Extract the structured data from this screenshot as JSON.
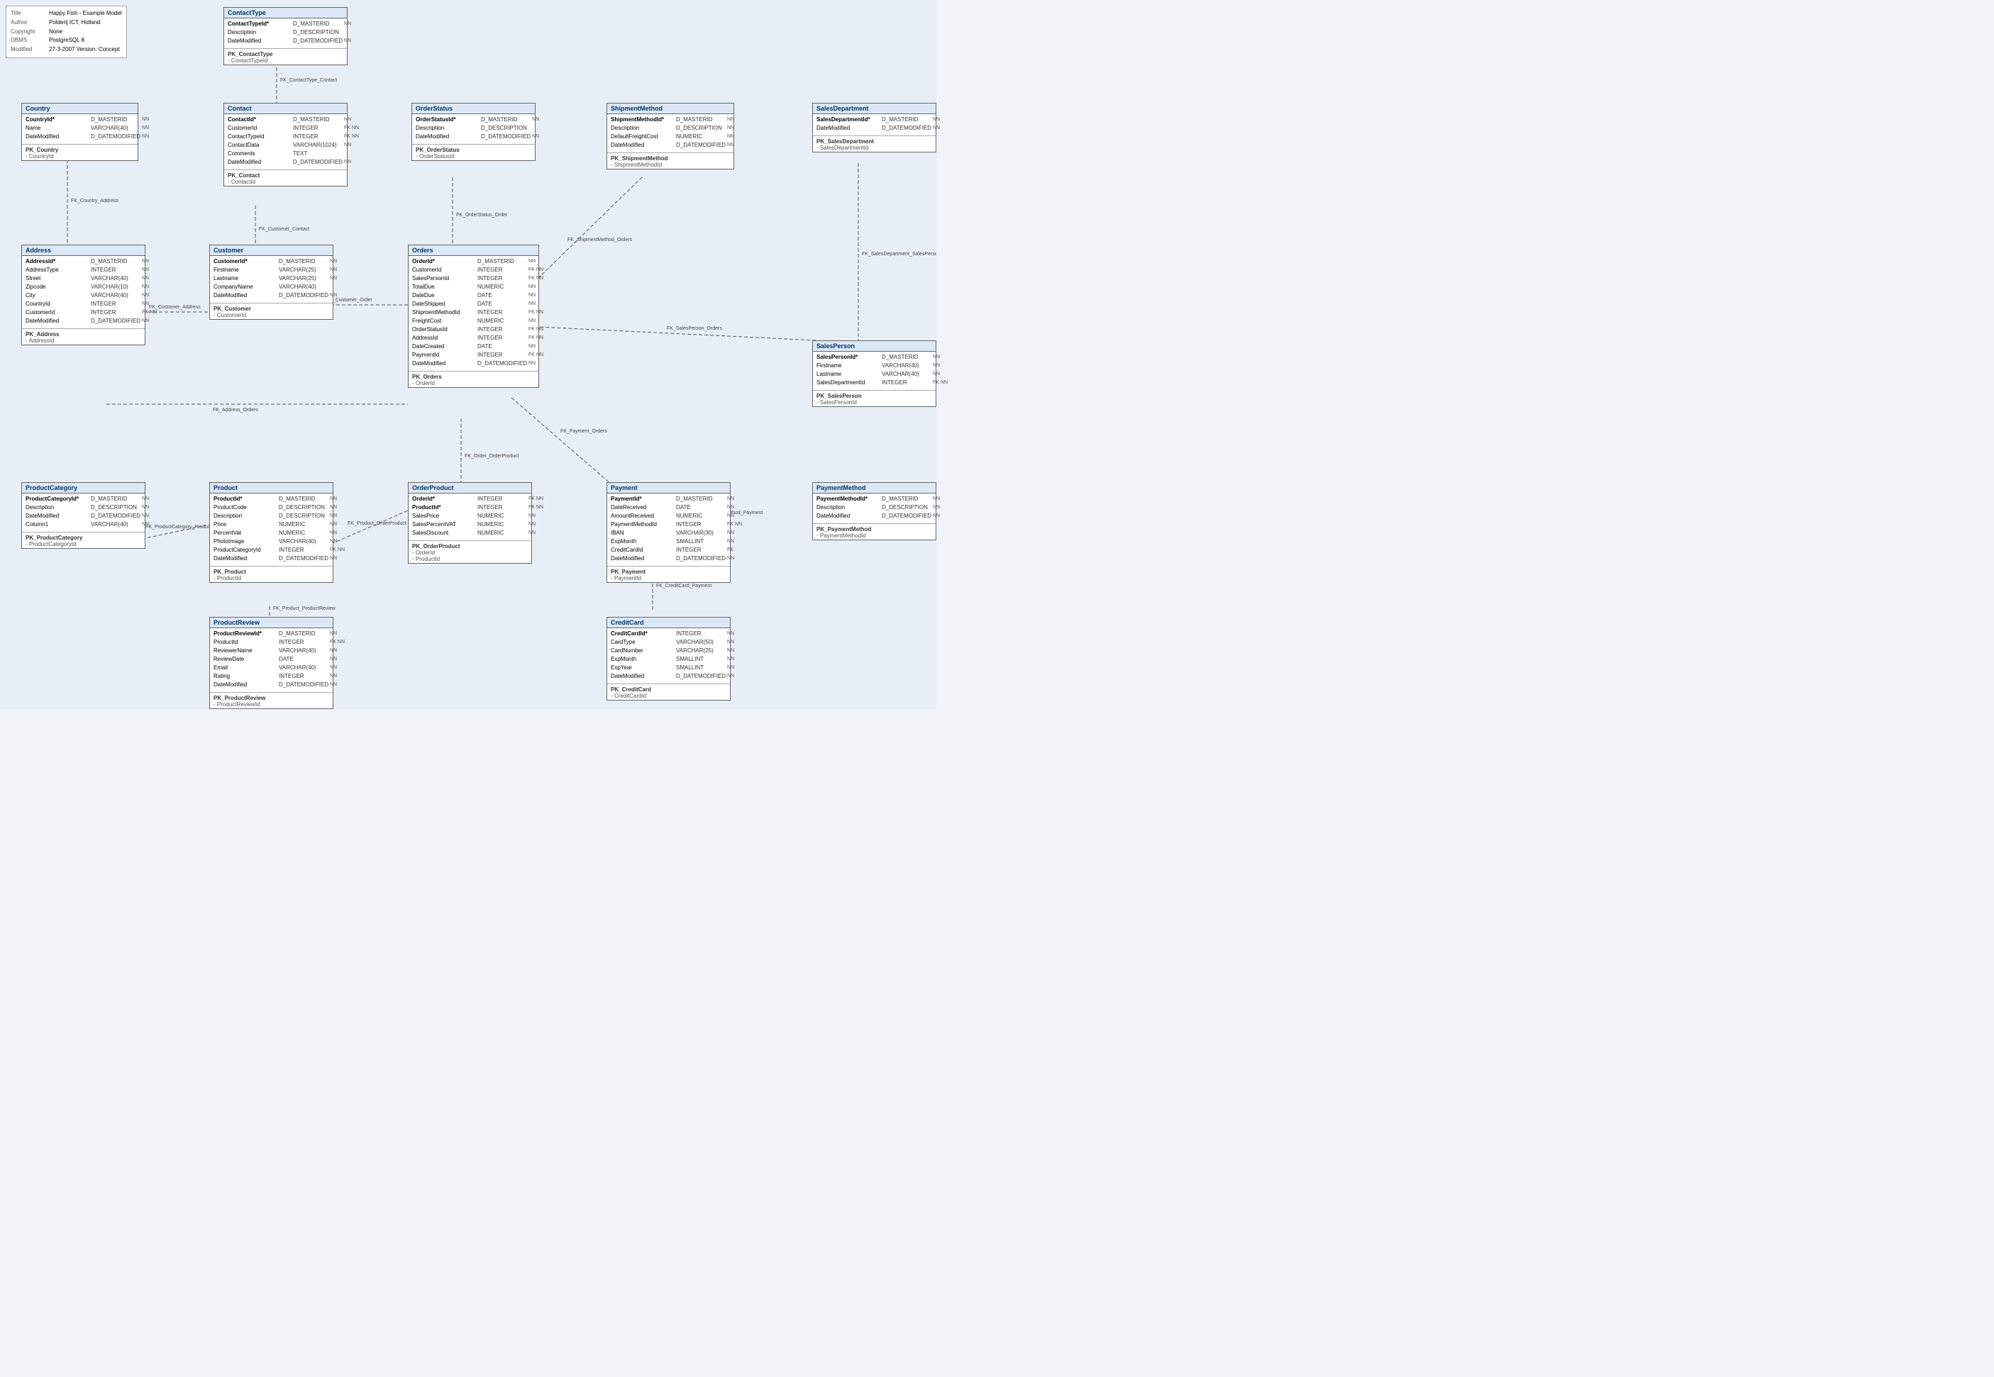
{
  "meta": {
    "title_label": "Title",
    "title_value": "Happy Fish - Example Model",
    "author_label": "Author",
    "author_value": "Polderij ICT, Holland",
    "copyright_label": "Copyright",
    "copyright_value": "None",
    "dbms_label": "DBMS",
    "dbms_value": "PostgreSQL 8",
    "modified_label": "Modified",
    "modified_value": "27-3-2007 Version: Concept"
  },
  "entities": {
    "contactType": {
      "title": "ContactType",
      "fields": [
        {
          "name": "ContactTypeId*",
          "type": "D_MASTERID",
          "flags": [
            "NN"
          ],
          "pk": true
        },
        {
          "name": "Description",
          "type": "D_DESCRIPTION",
          "flags": []
        },
        {
          "name": "DateModified",
          "type": "D_DATEMODIFIED",
          "flags": [
            "NN"
          ]
        }
      ],
      "pk": "PK_ContactType",
      "pk_fields": [
        "- ContactTypeId"
      ]
    },
    "contact": {
      "title": "Contact",
      "fields": [
        {
          "name": "ContactId*",
          "type": "D_MASTERID",
          "flags": [
            "NN"
          ],
          "pk": true
        },
        {
          "name": "CustomerId",
          "type": "INTEGER",
          "flags": [
            "FK",
            "NN"
          ]
        },
        {
          "name": "ContactTypeId",
          "type": "INTEGER",
          "flags": [
            "FK",
            "NN"
          ]
        },
        {
          "name": "ContactData",
          "type": "VARCHAR(1024)",
          "flags": [
            "NN"
          ]
        },
        {
          "name": "Comments",
          "type": "TEXT",
          "flags": []
        },
        {
          "name": "DateModified",
          "type": "D_DATEMODIFIED",
          "flags": [
            "NN"
          ]
        }
      ],
      "pk": "PK_Contact",
      "pk_fields": [
        "- ContactId"
      ]
    },
    "orderStatus": {
      "title": "OrderStatus",
      "fields": [
        {
          "name": "OrderStatusId*",
          "type": "D_MASTERID",
          "flags": [
            "NN"
          ],
          "pk": true
        },
        {
          "name": "Description",
          "type": "D_DESCRIPTION",
          "flags": []
        },
        {
          "name": "DateModified",
          "type": "D_DATEMODIFIED",
          "flags": [
            "NN"
          ]
        }
      ],
      "pk": "PK_OrderStatus",
      "pk_fields": [
        "- OrderStatusId"
      ]
    },
    "shipmentMethod": {
      "title": "ShipmentMethod",
      "fields": [
        {
          "name": "ShipmentMethodId*",
          "type": "D_MASTERID",
          "flags": [
            "NN"
          ],
          "pk": true
        },
        {
          "name": "Description",
          "type": "D_DESCRIPTION",
          "flags": [
            "NN"
          ]
        },
        {
          "name": "DefaultFreightCost",
          "type": "NUMERIC",
          "flags": [
            "NN"
          ]
        },
        {
          "name": "DateModified",
          "type": "D_DATEMODIFIED",
          "flags": [
            "NN"
          ]
        }
      ],
      "pk": "PK_ShipmentMethod",
      "pk_fields": [
        "- ShipmentMethodId"
      ]
    },
    "salesDepartment": {
      "title": "SalesDepartment",
      "fields": [
        {
          "name": "SalesDepartmentId*",
          "type": "D_MASTERID",
          "flags": [
            "NN"
          ],
          "pk": true
        },
        {
          "name": "DateModified",
          "type": "D_DATEMODIFIED",
          "flags": [
            "NN"
          ]
        }
      ],
      "pk": "PK_SalesDepartment",
      "pk_fields": [
        "- SalesDepartmentId"
      ]
    },
    "country": {
      "title": "Country",
      "fields": [
        {
          "name": "CountryId*",
          "type": "D_MASTERID",
          "flags": [
            "NN"
          ],
          "pk": true
        },
        {
          "name": "Name",
          "type": "VARCHAR(40)",
          "flags": [
            "NN"
          ]
        },
        {
          "name": "DateModified",
          "type": "D_DATEMODIFIED",
          "flags": [
            "NN"
          ]
        }
      ],
      "pk": "PK_Country",
      "pk_fields": [
        "- CountryId"
      ]
    },
    "address": {
      "title": "Address",
      "fields": [
        {
          "name": "AddressId*",
          "type": "D_MASTERID",
          "flags": [
            "NN"
          ],
          "pk": true
        },
        {
          "name": "AddressType",
          "type": "INTEGER",
          "flags": [
            "NN"
          ]
        },
        {
          "name": "Street",
          "type": "VARCHAR(40)",
          "flags": [
            "NN"
          ]
        },
        {
          "name": "Zipcode",
          "type": "VARCHAR(10)",
          "flags": [
            "NN"
          ]
        },
        {
          "name": "City",
          "type": "VARCHAR(40)",
          "flags": [
            "NN"
          ]
        },
        {
          "name": "CountryId",
          "type": "INTEGER",
          "flags": [
            "NN"
          ]
        },
        {
          "name": "CustomerId",
          "type": "INTEGER",
          "flags": [
            "FK",
            "NN"
          ]
        },
        {
          "name": "DateModified",
          "type": "D_DATEMODIFIED",
          "flags": [
            "NN"
          ]
        }
      ],
      "pk": "PK_Address",
      "pk_fields": [
        "- AddressId"
      ]
    },
    "customer": {
      "title": "Customer",
      "fields": [
        {
          "name": "CustomerId*",
          "type": "D_MASTERID",
          "flags": [
            "NN"
          ],
          "pk": true
        },
        {
          "name": "Firstname",
          "type": "VARCHAR(25)",
          "flags": [
            "NN"
          ]
        },
        {
          "name": "Lastname",
          "type": "VARCHAR(25)",
          "flags": [
            "NN"
          ]
        },
        {
          "name": "CompanyName",
          "type": "VARCHAR(40)",
          "flags": []
        },
        {
          "name": "DateModified",
          "type": "D_DATEMODIFIED",
          "flags": [
            "NN"
          ]
        }
      ],
      "pk": "PK_Customer",
      "pk_fields": [
        "- CustomerId"
      ]
    },
    "orders": {
      "title": "Orders",
      "fields": [
        {
          "name": "OrderId*",
          "type": "D_MASTERID",
          "flags": [
            "NN"
          ],
          "pk": true
        },
        {
          "name": "CustomerId",
          "type": "INTEGER",
          "flags": [
            "FK",
            "NN"
          ]
        },
        {
          "name": "SalesPersonId",
          "type": "INTEGER",
          "flags": [
            "FK",
            "NN"
          ]
        },
        {
          "name": "TotalDue",
          "type": "NUMERIC",
          "flags": [
            "NN"
          ]
        },
        {
          "name": "DateDue",
          "type": "DATE",
          "flags": [
            "NN"
          ]
        },
        {
          "name": "DateShipped",
          "type": "DATE",
          "flags": [
            "NN"
          ]
        },
        {
          "name": "ShipmentMethodId",
          "type": "INTEGER",
          "flags": [
            "FK",
            "NN"
          ]
        },
        {
          "name": "FreightCost",
          "type": "NUMERIC",
          "flags": [
            "NN"
          ]
        },
        {
          "name": "OrderStatusId",
          "type": "INTEGER",
          "flags": [
            "FK",
            "NN"
          ]
        },
        {
          "name": "AddressId",
          "type": "INTEGER",
          "flags": [
            "FK",
            "NN"
          ]
        },
        {
          "name": "DateCreated",
          "type": "DATE",
          "flags": [
            "NN"
          ]
        },
        {
          "name": "PaymentId",
          "type": "INTEGER",
          "flags": [
            "FK",
            "NN"
          ]
        },
        {
          "name": "DateModified",
          "type": "D_DATEMODIFIED",
          "flags": [
            "NN"
          ]
        }
      ],
      "pk": "PK_Orders",
      "pk_fields": [
        "- OrderId"
      ]
    },
    "salesPerson": {
      "title": "SalesPerson",
      "fields": [
        {
          "name": "SalesPersonId*",
          "type": "D_MASTERID",
          "flags": [
            "NN"
          ],
          "pk": true
        },
        {
          "name": "Firstname",
          "type": "VARCHAR(40)",
          "flags": [
            "NN"
          ]
        },
        {
          "name": "Lastname",
          "type": "VARCHAR(40)",
          "flags": [
            "NN"
          ]
        },
        {
          "name": "SalesDepartmentId",
          "type": "INTEGER",
          "flags": [
            "FK",
            "NN"
          ]
        }
      ],
      "pk": "PK_SalesPerson",
      "pk_fields": [
        "- SalesPersonId"
      ]
    },
    "productCategory": {
      "title": "ProductCategory",
      "fields": [
        {
          "name": "ProductCategoryId*",
          "type": "D_MASTERID",
          "flags": [
            "NN"
          ],
          "pk": true
        },
        {
          "name": "Description",
          "type": "D_DESCRIPTION",
          "flags": [
            "NN"
          ]
        },
        {
          "name": "DateModified",
          "type": "D_DATEMODIFIED",
          "flags": [
            "NN"
          ]
        },
        {
          "name": "Column1",
          "type": "VARCHAR(40)",
          "flags": [
            "NN"
          ]
        }
      ],
      "pk": "PK_ProductCategory",
      "pk_fields": [
        "- ProductCategoryId"
      ]
    },
    "product": {
      "title": "Product",
      "fields": [
        {
          "name": "ProductId*",
          "type": "D_MASTERID",
          "flags": [
            "NN"
          ],
          "pk": true
        },
        {
          "name": "ProductCode",
          "type": "D_DESCRIPTION",
          "flags": [
            "NN"
          ]
        },
        {
          "name": "Description",
          "type": "D_DESCRIPTION",
          "flags": [
            "NN"
          ]
        },
        {
          "name": "Price",
          "type": "NUMERIC",
          "flags": [
            "NN"
          ]
        },
        {
          "name": "PercentVat",
          "type": "NUMERIC",
          "flags": [
            "NN"
          ]
        },
        {
          "name": "PhotoImage",
          "type": "VARCHAR(40)",
          "flags": [
            "NN"
          ]
        },
        {
          "name": "ProductCategoryId",
          "type": "INTEGER",
          "flags": [
            "FK",
            "NN"
          ]
        },
        {
          "name": "DateModified",
          "type": "D_DATEMODIFIED",
          "flags": [
            "NN"
          ]
        }
      ],
      "pk": "PK_Product",
      "pk_fields": [
        "- ProductId"
      ]
    },
    "orderProduct": {
      "title": "OrderProduct",
      "fields": [
        {
          "name": "OrderId*",
          "type": "INTEGER",
          "flags": [
            "FK",
            "NN"
          ],
          "pk": true
        },
        {
          "name": "ProductId*",
          "type": "INTEGER",
          "flags": [
            "FK",
            "NN"
          ],
          "pk": true
        },
        {
          "name": "SalesPrice",
          "type": "NUMERIC",
          "flags": [
            "NN"
          ]
        },
        {
          "name": "SalesPercentVAT",
          "type": "NUMERIC",
          "flags": [
            "NN"
          ]
        },
        {
          "name": "SalesDiscount",
          "type": "NUMERIC",
          "flags": [
            "NN"
          ]
        }
      ],
      "pk": "PK_OrderProduct",
      "pk_fields": [
        "- OrderId",
        "- ProductId"
      ]
    },
    "payment": {
      "title": "Payment",
      "fields": [
        {
          "name": "PaymentId*",
          "type": "D_MASTERID",
          "flags": [
            "NN"
          ],
          "pk": true
        },
        {
          "name": "DateReceived",
          "type": "DATE",
          "flags": [
            "NN"
          ]
        },
        {
          "name": "AmountReceived",
          "type": "NUMERIC",
          "flags": [
            "NN"
          ]
        },
        {
          "name": "PaymentMethodId",
          "type": "INTEGER",
          "flags": [
            "FK",
            "NN"
          ]
        },
        {
          "name": "IBAN",
          "type": "VARCHAR(30)",
          "flags": [
            "NN"
          ]
        },
        {
          "name": "ExpMonth",
          "type": "SMALLINT",
          "flags": [
            "NN"
          ]
        },
        {
          "name": "CreditCardId",
          "type": "INTEGER",
          "flags": [
            "FK"
          ]
        },
        {
          "name": "DateModified",
          "type": "D_DATEMODIFIED",
          "flags": [
            "NN"
          ]
        }
      ],
      "pk": "PK_Payment",
      "pk_fields": [
        "- PaymentId"
      ]
    },
    "paymentMethod": {
      "title": "PaymentMethod",
      "fields": [
        {
          "name": "PaymentMethodId*",
          "type": "D_MASTERID",
          "flags": [
            "NN"
          ],
          "pk": true
        },
        {
          "name": "Description",
          "type": "D_DESCRIPTION",
          "flags": [
            "NN"
          ]
        },
        {
          "name": "DateModified",
          "type": "D_DATEMODIFIED",
          "flags": [
            "NN"
          ]
        }
      ],
      "pk": "PK_PaymentMethod",
      "pk_fields": [
        "- PaymentMethodId"
      ]
    },
    "productReview": {
      "title": "ProductReview",
      "fields": [
        {
          "name": "ProductReviewId*",
          "type": "D_MASTERID",
          "flags": [
            "NN"
          ],
          "pk": true
        },
        {
          "name": "ProductId",
          "type": "INTEGER",
          "flags": [
            "FK",
            "NN"
          ]
        },
        {
          "name": "ReviewerName",
          "type": "VARCHAR(40)",
          "flags": [
            "NN"
          ]
        },
        {
          "name": "ReviewDate",
          "type": "DATE",
          "flags": [
            "NN"
          ]
        },
        {
          "name": "Email",
          "type": "VARCHAR(40)",
          "flags": [
            "NN"
          ]
        },
        {
          "name": "Rating",
          "type": "INTEGER",
          "flags": [
            "NN"
          ]
        },
        {
          "name": "DateModified",
          "type": "D_DATEMODIFIED",
          "flags": [
            "NN"
          ]
        }
      ],
      "pk": "PK_ProductReview",
      "pk_fields": [
        "- ProductReviewId"
      ]
    },
    "creditCard": {
      "title": "CreditCard",
      "fields": [
        {
          "name": "CreditCardId*",
          "type": "INTEGER",
          "flags": [
            "NN"
          ],
          "pk": true
        },
        {
          "name": "CardType",
          "type": "VARCHAR(50)",
          "flags": [
            "NN"
          ]
        },
        {
          "name": "CardNumber",
          "type": "VARCHAR(25)",
          "flags": [
            "NN"
          ]
        },
        {
          "name": "ExpMonth",
          "type": "SMALLINT",
          "flags": [
            "NN"
          ]
        },
        {
          "name": "ExpYear",
          "type": "SMALLINT",
          "flags": [
            "NN"
          ]
        },
        {
          "name": "DateModified",
          "type": "D_DATEMODIFIED",
          "flags": [
            "NN"
          ]
        }
      ],
      "pk": "PK_CreditCard",
      "pk_fields": [
        "- CreditCardId"
      ]
    }
  },
  "relations": [
    {
      "label": "FK_ContactType_Contact",
      "from": "contactType",
      "to": "contact"
    },
    {
      "label": "FK_Country_Address",
      "from": "country",
      "to": "address"
    },
    {
      "label": "FK_Customer_Address",
      "from": "customer",
      "to": "address"
    },
    {
      "label": "FK_Customer_Contact",
      "from": "customer",
      "to": "contact"
    },
    {
      "label": "FK_Customer_Order",
      "from": "customer",
      "to": "orders"
    },
    {
      "label": "FK_OrderStatus_Order",
      "from": "orderStatus",
      "to": "orders"
    },
    {
      "label": "FK_ShipmentMethod_Orders",
      "from": "shipmentMethod",
      "to": "orders"
    },
    {
      "label": "FK_SalesPerson_Orders",
      "from": "salesPerson",
      "to": "orders"
    },
    {
      "label": "FK_Payment_Orders",
      "from": "payment",
      "to": "orders"
    },
    {
      "label": "FK_Address_Orders",
      "from": "address",
      "to": "orders"
    },
    {
      "label": "FK_Order_OrderProduct",
      "from": "orders",
      "to": "orderProduct"
    },
    {
      "label": "FK_Product_OrderProduct",
      "from": "product",
      "to": "orderProduct"
    },
    {
      "label": "FK_ProductCategory_Product",
      "from": "productCategory",
      "to": "product"
    },
    {
      "label": "FK_Product_ProductReview",
      "from": "product",
      "to": "productReview"
    },
    {
      "label": "FK_PaymentMethod_Payment",
      "from": "paymentMethod",
      "to": "payment"
    },
    {
      "label": "FK_CreditCard_Payment",
      "from": "creditCard",
      "to": "payment"
    },
    {
      "label": "FK_SalesDepartment_SalesPerson",
      "from": "salesDepartment",
      "to": "salesPerson"
    }
  ]
}
